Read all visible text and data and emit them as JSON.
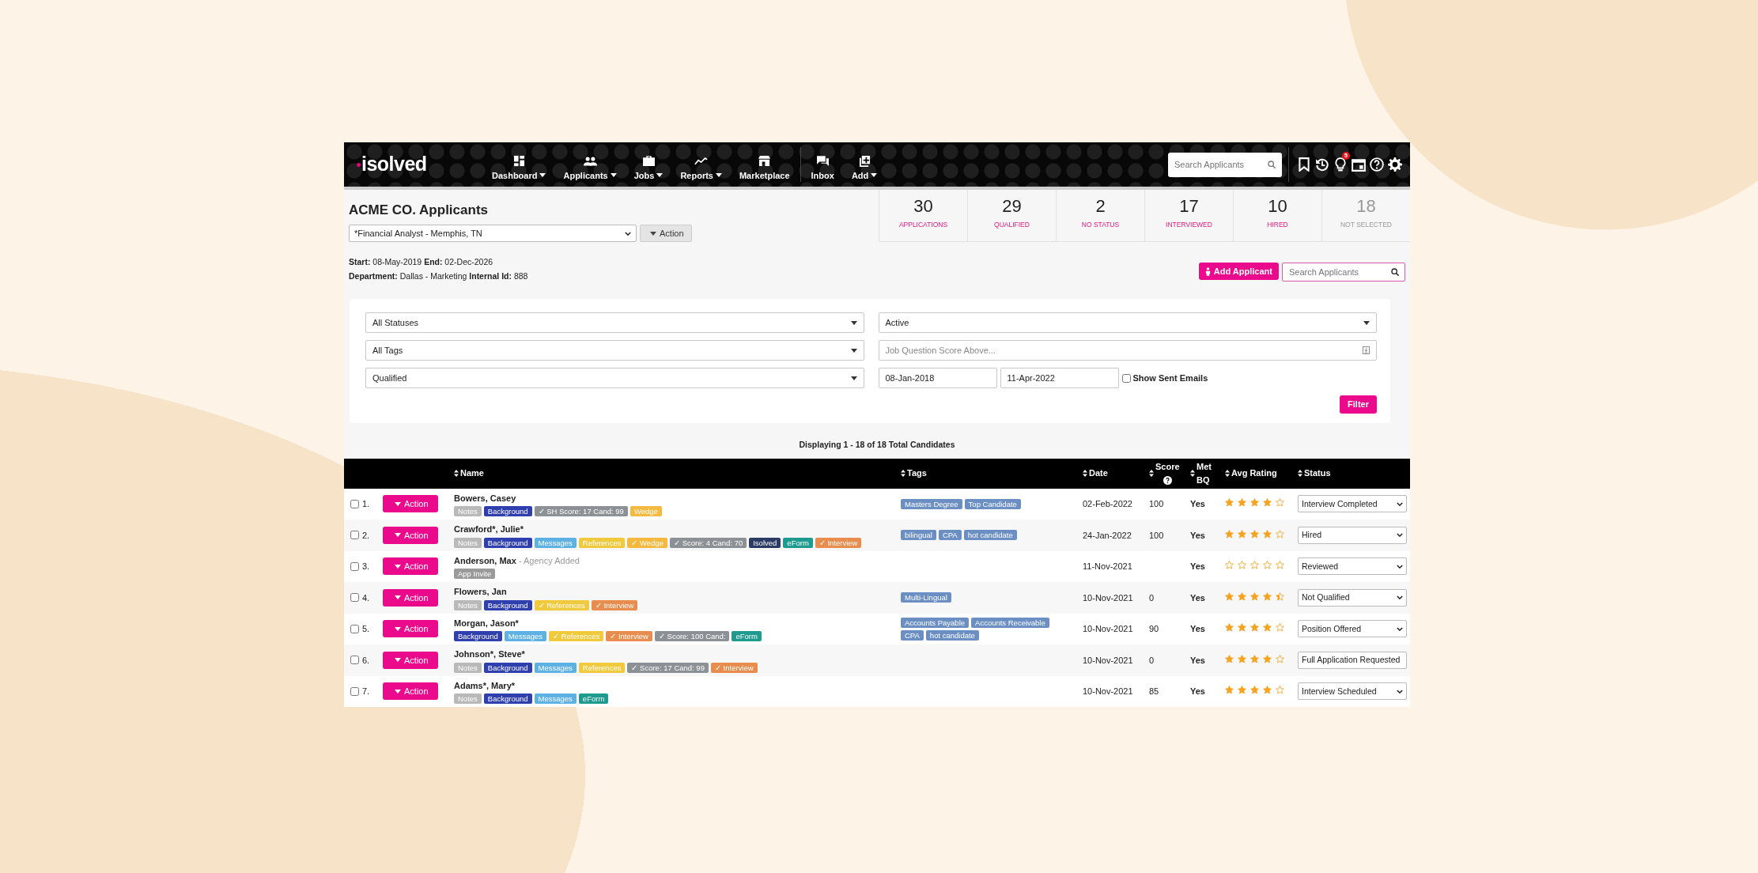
{
  "navbar": {
    "logo": "isolved",
    "menu": [
      {
        "label": "Dashboard",
        "dropdown": true
      },
      {
        "label": "Applicants",
        "dropdown": true
      },
      {
        "label": "Jobs",
        "dropdown": true
      },
      {
        "label": "Reports",
        "dropdown": true
      },
      {
        "label": "Marketplace",
        "dropdown": false
      },
      {
        "label": "Inbox",
        "dropdown": false
      },
      {
        "label": "Add",
        "dropdown": true
      }
    ],
    "search": {
      "placeholder": "Search Applicants"
    },
    "notification_count": "5"
  },
  "page": {
    "title": "ACME CO. Applicants",
    "job_select": "*Financial Analyst - Memphis, TN",
    "action_button": "Action",
    "details": [
      "**Start:** 08-May-2019 **End:** 02-Dec-2026",
      "**Department:** Dallas - Marketing **Internal Id:** 888"
    ]
  },
  "stats": [
    {
      "value": "30",
      "label": "APPLICATIONS",
      "dimmed": false
    },
    {
      "value": "29",
      "label": "QUALIFIED",
      "dimmed": false
    },
    {
      "value": "2",
      "label": "NO STATUS",
      "dimmed": false
    },
    {
      "value": "17",
      "label": "INTERVIEWED",
      "dimmed": false
    },
    {
      "value": "10",
      "label": "HIRED",
      "dimmed": false
    },
    {
      "value": "18",
      "label": "NOT SELECTED",
      "dimmed": true
    }
  ],
  "add_applicant": "Add Applicant",
  "search": {
    "placeholder": "Search Applicants"
  },
  "filters": {
    "status": "All Statuses",
    "tags": "All Tags",
    "qualification": "Qualified",
    "active": "Active",
    "score": {
      "placeholder": "Job Question Score Above..."
    },
    "date_from": "08-Jan-2018",
    "date_to": "11-Apr-2022",
    "show_sent_emails": {
      "label": "Show Sent Emails",
      "checked": false
    },
    "button": "Filter"
  },
  "summary": "Displaying 1 - 18 of 18 Total Candidates",
  "table": {
    "columns": [
      {
        "label": "Name",
        "help": false
      },
      {
        "label": "Tags",
        "help": false
      },
      {
        "label": "Date",
        "help": false
      },
      {
        "label": "Score",
        "help": true
      },
      {
        "label": "Met BQ",
        "help": false
      },
      {
        "label": "Avg Rating",
        "help": false
      },
      {
        "label": "Status",
        "help": false
      }
    ],
    "rows": [
      {
        "number": "1.",
        "checked": false,
        "action": "Action",
        "name": "Bowers, Casey",
        "labels": [
          {
            "text": "Notes",
            "color": "#b9b9b9"
          },
          {
            "text": "Background",
            "color": "#2f3fae"
          },
          {
            "text": "✓ SH Score: 17 Cand: 99",
            "color": "#8b9194"
          },
          {
            "text": "Wedge",
            "color": "#f6b93f"
          }
        ],
        "tags": [
          "Masters Degree",
          "Top Candidate"
        ],
        "date": "02-Feb-2022",
        "score": "100",
        "met_bq": "Yes",
        "stars": 4,
        "status": "Interview Completed"
      },
      {
        "number": "2.",
        "checked": false,
        "action": "Action",
        "name": "Crawford*, Julie*",
        "labels": [
          {
            "text": "Notes",
            "color": "#b9b9b9"
          },
          {
            "text": "Background",
            "color": "#2f3fae"
          },
          {
            "text": "Messages",
            "color": "#5eb1e3"
          },
          {
            "text": "References",
            "color": "#f1c93c"
          },
          {
            "text": "✓ Wedge",
            "color": "#f6b93f"
          },
          {
            "text": "✓ Score: 4 Cand: 70",
            "color": "#8b9194"
          },
          {
            "text": "Isolved",
            "color": "#2c3b66"
          },
          {
            "text": "eForm",
            "color": "#1f9a8e"
          },
          {
            "text": "✓ Interview",
            "color": "#e88d4d"
          }
        ],
        "tags": [
          "bilingual",
          "CPA",
          "hot candidate"
        ],
        "date": "24-Jan-2022",
        "score": "100",
        "met_bq": "Yes",
        "stars": 4,
        "status": "Hired"
      },
      {
        "number": "3.",
        "checked": false,
        "action": "Action",
        "name": "Anderson, Max",
        "note": "- Agency Added",
        "labels": [
          {
            "text": "App Invite",
            "color": "#9a9a9a"
          }
        ],
        "tags": [],
        "date": "11-Nov-2021",
        "met_bq": "Yes",
        "stars": 0,
        "status": "Reviewed"
      },
      {
        "number": "4.",
        "checked": false,
        "action": "Action",
        "name": "Flowers, Jan",
        "labels": [
          {
            "text": "Notes",
            "color": "#b9b9b9"
          },
          {
            "text": "Background",
            "color": "#2f3fae"
          },
          {
            "text": "✓ References",
            "color": "#f1c93c"
          },
          {
            "text": "✓ Interview",
            "color": "#e88d4d"
          }
        ],
        "tags": [
          "Multi-Lingual"
        ],
        "date": "10-Nov-2021",
        "score": "0",
        "met_bq": "Yes",
        "stars": 4.5,
        "status": "Not Qualified"
      },
      {
        "number": "5.",
        "checked": false,
        "action": "Action",
        "name": "Morgan, Jason*",
        "labels": [
          {
            "text": "Background",
            "color": "#2f3fae"
          },
          {
            "text": "Messages",
            "color": "#5eb1e3"
          },
          {
            "text": "✓ References",
            "color": "#f1c93c"
          },
          {
            "text": "✓ Interview",
            "color": "#e88d4d"
          },
          {
            "text": "✓ Score: 100 Cand:",
            "color": "#8b9194"
          },
          {
            "text": "eForm",
            "color": "#1f9a8e"
          }
        ],
        "tags": [
          "Accounts Payable",
          "Accounts Receivable",
          "CPA",
          "hot candidate"
        ],
        "date": "10-Nov-2021",
        "score": "90",
        "met_bq": "Yes",
        "stars": 4,
        "status": "Position Offered"
      },
      {
        "number": "6.",
        "checked": false,
        "action": "Action",
        "name": "Johnson*, Steve*",
        "labels": [
          {
            "text": "Notes",
            "color": "#b9b9b9"
          },
          {
            "text": "Background",
            "color": "#2f3fae"
          },
          {
            "text": "Messages",
            "color": "#5eb1e3"
          },
          {
            "text": "References",
            "color": "#f1c93c"
          },
          {
            "text": "✓ Score: 17 Cand: 99",
            "color": "#8b9194"
          },
          {
            "text": "✓ Interview",
            "color": "#e88d4d"
          }
        ],
        "tags": [],
        "date": "10-Nov-2021",
        "score": "0",
        "met_bq": "Yes",
        "stars": 4,
        "status": "Full Application Requested"
      },
      {
        "number": "7.",
        "checked": false,
        "action": "Action",
        "name": "Adams*, Mary*",
        "labels": [
          {
            "text": "Notes",
            "color": "#b9b9b9"
          },
          {
            "text": "Background",
            "color": "#2f3fae"
          },
          {
            "text": "Messages",
            "color": "#5eb1e3"
          },
          {
            "text": "eForm",
            "color": "#1f9a8e"
          }
        ],
        "tags": [],
        "date": "10-Nov-2021",
        "score": "85",
        "met_bq": "Yes",
        "stars": 4,
        "status": "Interview Scheduled"
      }
    ]
  }
}
